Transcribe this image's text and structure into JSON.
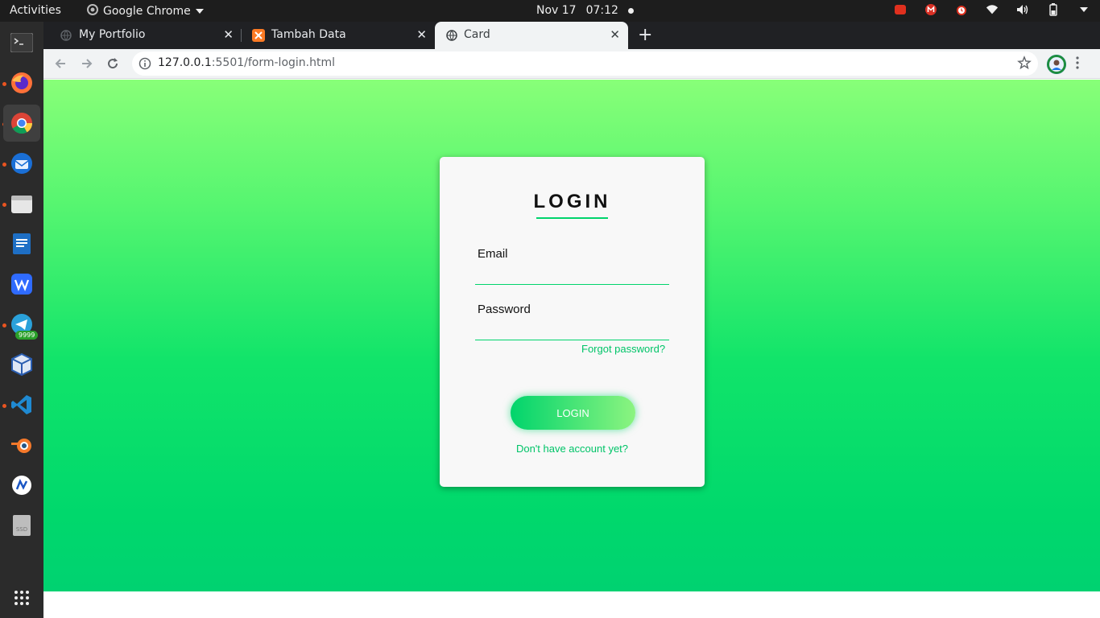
{
  "topbar": {
    "activities": "Activities",
    "app_name": "Google Chrome",
    "date": "Nov 17",
    "time": "07:12",
    "tray_icons": [
      "cpu-temp-icon",
      "gmail-icon",
      "alarm-icon",
      "wifi-icon",
      "volume-icon",
      "battery-icon"
    ]
  },
  "dock": {
    "items": [
      "terminal-icon",
      "firefox-icon",
      "chrome-icon",
      "thunderbird-icon",
      "files-icon",
      "writer-icon",
      "wps-icon",
      "telegram-icon",
      "virtualbox-icon",
      "vscode-icon",
      "blender-icon",
      "app-icon",
      "ssd-drive-icon",
      "show-apps-icon"
    ],
    "telegram_badge": "9999",
    "ssd_label": "SSD"
  },
  "browser": {
    "tabs": [
      {
        "title": "My Portfolio",
        "icon": "globe-icon"
      },
      {
        "title": "Tambah Data",
        "icon": "xampp-icon"
      },
      {
        "title": "Card",
        "icon": "globe-icon"
      }
    ],
    "new_tab": "+",
    "url_host": "127.0.0.1",
    "url_rest": ":5501/form-login.html"
  },
  "login": {
    "title": "LOGIN",
    "email_label": "Email",
    "email_value": "",
    "password_label": "Password",
    "password_value": "",
    "forgot": "Forgot password?",
    "button": "LOGIN",
    "signup": "Don't have account yet?"
  },
  "colors": {
    "accent": "#00d46c",
    "link": "#00c468",
    "gradient_top": "#88ff78",
    "gradient_bottom": "#00d271"
  }
}
